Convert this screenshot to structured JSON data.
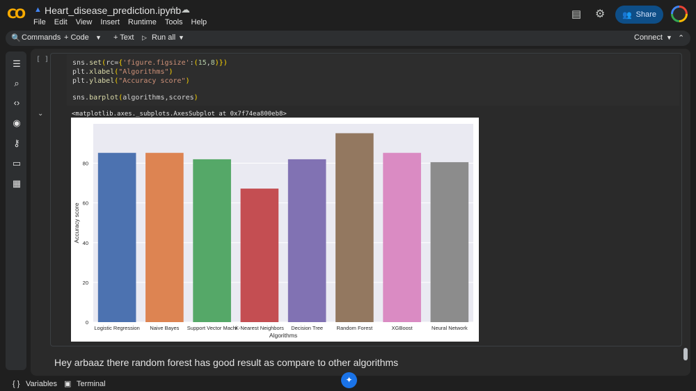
{
  "header": {
    "logo": "CO",
    "notebook_title": "Heart_disease_prediction.ipynb",
    "menu": [
      "File",
      "Edit",
      "View",
      "Insert",
      "Runtime",
      "Tools",
      "Help"
    ],
    "share_label": "Share"
  },
  "toolbar": {
    "commands_label": "Commands",
    "code_label": "+ Code",
    "text_label": "+ Text",
    "run_all_label": "Run all",
    "connect_label": "Connect"
  },
  "sidebar_icons": [
    "table-of-contents-icon",
    "find-icon",
    "code-snippets-icon",
    "variables-inspector-icon",
    "secrets-key-icon",
    "files-folder-icon",
    "data-table-icon"
  ],
  "cell": {
    "run_indicator": "[ ]",
    "code_lines": [
      "sns.set(rc={'figure.figsize':(15,8)})",
      "plt.xlabel(\"Algorithms\")",
      "plt.ylabel(\"Accuracy score\")",
      "",
      "sns.barplot(algorithms,scores)"
    ],
    "output_text": "<matplotlib.axes._subplots.AxesSubplot at 0x7f74ea800eb8>"
  },
  "chart_data": {
    "type": "bar",
    "categories": [
      "Logistic Regression",
      "Naive Bayes",
      "Support Vector Machine",
      "K-Nearest Neighbors",
      "Decision Tree",
      "Random Forest",
      "XGBoost",
      "Neural Network"
    ],
    "category_labels_shown": [
      "Logistic Regression",
      "Naive Bayes",
      "Support Vector Machi",
      "K-Nearest Neighbors",
      "Decision Tree",
      "Random Forest",
      "XGBoost",
      "Neural Network"
    ],
    "values": [
      85.2,
      85.2,
      81.97,
      67.21,
      81.97,
      95.08,
      85.2,
      80.5
    ],
    "colors": [
      "#4c72b0",
      "#dd8452",
      "#55a868",
      "#c44e52",
      "#8172b3",
      "#937860",
      "#da8bc3",
      "#8c8c8c"
    ],
    "xlabel": "Algorithms",
    "ylabel": "Accuracy score",
    "yticks": [
      0,
      20,
      40,
      60,
      80
    ],
    "ylim": [
      0,
      99.8
    ],
    "background": "#eaeaf2",
    "grid": true
  },
  "message": "Hey arbaaz there random forest has good result as compare to other algorithms",
  "status_bar": {
    "variables_label": "Variables",
    "terminal_label": "Terminal"
  }
}
